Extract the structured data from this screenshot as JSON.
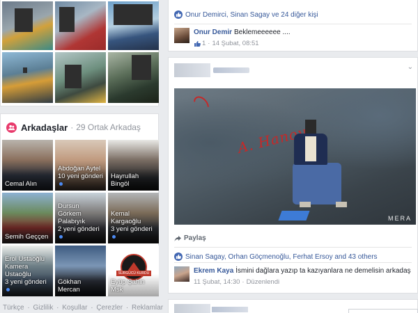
{
  "friends": {
    "title": "Arkadaşlar",
    "separator": "·",
    "mutual_count": "29 Ortak Arkadaş",
    "items": [
      {
        "name_line1": "Cemal Alın",
        "name_line2": ""
      },
      {
        "name_line1": "Abdoğan Aytel",
        "name_line2": "10 yeni gönderi"
      },
      {
        "name_line1": "Hayrullah Bingöl",
        "name_line2": ""
      },
      {
        "name_line1": "Semih Geççen",
        "name_line2": ""
      },
      {
        "name_line1": "Dursun Görkem",
        "name_line2": "Palabıyık",
        "name_line3": "2 yeni gönderi"
      },
      {
        "name_line1": "Kemal Kargaoğlu",
        "name_line2": "3 yeni gönderi"
      },
      {
        "name_line1": "Erol Ustaoğlu",
        "name_line2": "Kamera Ustaoğlu",
        "name_line3": "3 yeni gönderi"
      },
      {
        "name_line1": "Gökhan Mercan",
        "name_line2": ""
      },
      {
        "name_line1": "Eyüp Şahin Msk",
        "name_line2": "",
        "logo_text": "SÜRGÜCÜ KURDU"
      }
    ]
  },
  "footer": {
    "links": [
      "Türkçe",
      "Gizlilik",
      "Koşullar",
      "Çerezler",
      "Reklamlar"
    ],
    "sep": "·"
  },
  "post1": {
    "likes": "Onur Demirci, Sinan Sagay ve 24 diğer kişi",
    "comment": {
      "name": "Onur Demir",
      "text": "Beklemeeeeee ....",
      "like_count": "1",
      "dot": "·",
      "time": "14 Şubat, 08:51"
    }
  },
  "post2": {
    "chevron": "⌄",
    "photo_graffiti": "A. Hanoy",
    "watermark": "MERA",
    "share_label": "Paylaş",
    "likes": "Sinan Sagay, Orhan Göçmenoğlu, Ferhat Ersoy and 43 others",
    "comment": {
      "name": "Ekrem Kaya",
      "text": "İsmini dağlara yazıp ta kazıyanlara ne demelisin arkadaş",
      "time": "11 Şubat, 14:30",
      "dot": "·",
      "edited": "Düzenlendi"
    }
  },
  "colors": {
    "link": "#365899",
    "like": "#4267b2",
    "friends_icon": "#e83a6c",
    "bg": "#e9ebee"
  }
}
